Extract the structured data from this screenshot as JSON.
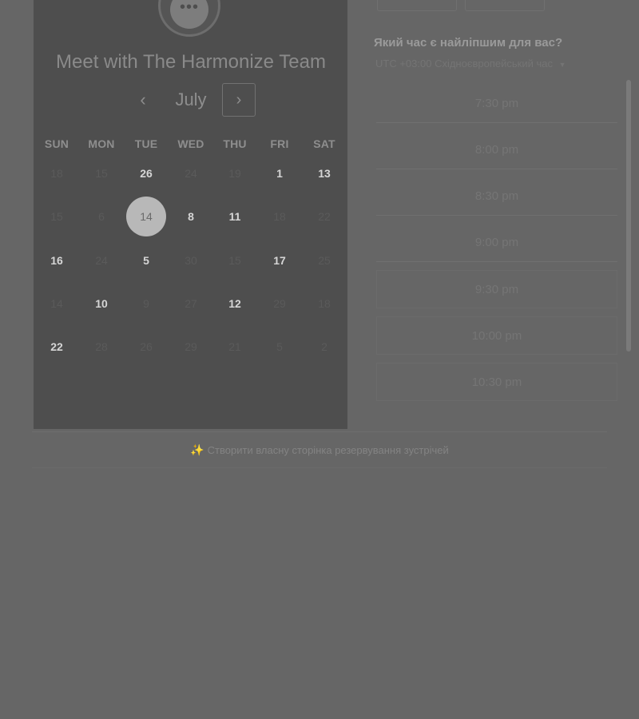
{
  "calendar": {
    "title": "Meet with The Harmonize Team",
    "month": "July",
    "prev_icon": "chevron-left-icon",
    "next_icon": "chevron-right-icon",
    "weekdays": [
      "SUN",
      "MON",
      "TUE",
      "WED",
      "THU",
      "FRI",
      "SAT"
    ],
    "weeks": [
      [
        {
          "label": "18",
          "available": false
        },
        {
          "label": "15",
          "available": false
        },
        {
          "label": "26",
          "available": true
        },
        {
          "label": "24",
          "available": false
        },
        {
          "label": "19",
          "available": false
        },
        {
          "label": "1",
          "available": true
        },
        {
          "label": "13",
          "available": true
        }
      ],
      [
        {
          "label": "15",
          "available": false
        },
        {
          "label": "6",
          "available": false
        },
        {
          "label": "14",
          "available": true,
          "selected": true
        },
        {
          "label": "8",
          "available": true
        },
        {
          "label": "11",
          "available": true
        },
        {
          "label": "18",
          "available": false
        },
        {
          "label": "22",
          "available": false
        }
      ],
      [
        {
          "label": "16",
          "available": true
        },
        {
          "label": "24",
          "available": false
        },
        {
          "label": "5",
          "available": true
        },
        {
          "label": "30",
          "available": false
        },
        {
          "label": "15",
          "available": false
        },
        {
          "label": "17",
          "available": true
        },
        {
          "label": "25",
          "available": false
        }
      ],
      [
        {
          "label": "14",
          "available": false
        },
        {
          "label": "10",
          "available": true
        },
        {
          "label": "9",
          "available": false
        },
        {
          "label": "27",
          "available": false
        },
        {
          "label": "12",
          "available": true
        },
        {
          "label": "29",
          "available": false
        },
        {
          "label": "18",
          "available": false
        }
      ],
      [
        {
          "label": "22",
          "available": true
        },
        {
          "label": "28",
          "available": false
        },
        {
          "label": "26",
          "available": false
        },
        {
          "label": "29",
          "available": false
        },
        {
          "label": "21",
          "available": false
        },
        {
          "label": "5",
          "available": false
        },
        {
          "label": "2",
          "available": false
        }
      ]
    ]
  },
  "times": {
    "heading": "Який час є найліпшим для вас?",
    "timezone": "UTC +03:00 Східноєвропейський час",
    "timezone_icon": "caret-down-icon",
    "slots": [
      "7:30 pm",
      "8:00 pm",
      "8:30 pm",
      "9:00 pm",
      "9:30 pm",
      "10:00 pm",
      "10:30 pm"
    ]
  },
  "footer": {
    "link_text": "Створити власну сторінка резервування зустрічей",
    "link_icon": "sparkle-icon"
  }
}
